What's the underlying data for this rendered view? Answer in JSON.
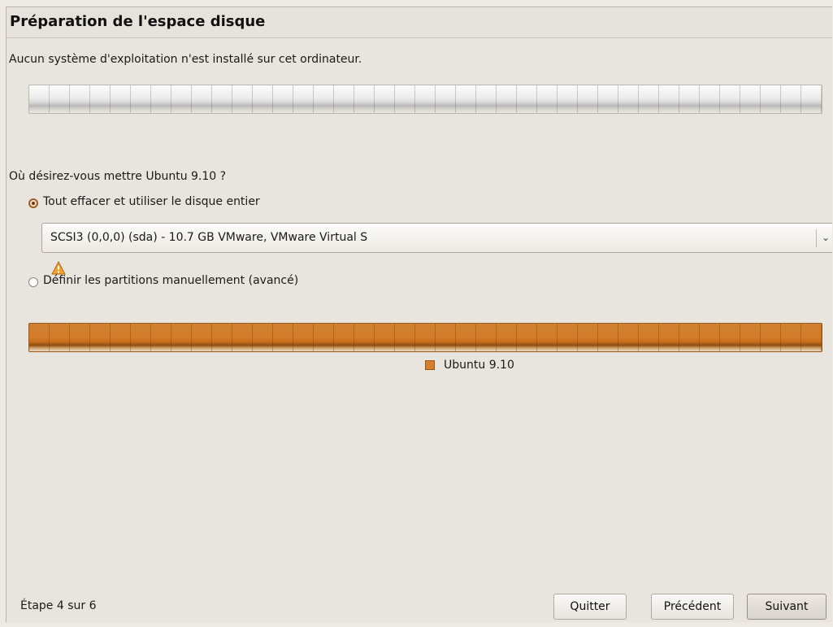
{
  "header": {
    "title": "Préparation de l'espace disque"
  },
  "disk_info": {
    "message": "Aucun système d'exploitation n'est installé sur cet ordinateur."
  },
  "installation": {
    "question": "Où désirez-vous mettre Ubuntu 9.10 ?",
    "option_erase": {
      "label": "Tout effacer et utiliser le disque entier",
      "selected": true
    },
    "disk_select": {
      "selected": "SCSI3 (0,0,0) (sda) - 10.7 GB VMware, VMware Virtual S"
    },
    "option_manual": {
      "label": "Définir les partitions manuellement (avancé)",
      "selected": false
    },
    "result_legend": {
      "label": "Ubuntu 9.10",
      "color": "#d6802c"
    }
  },
  "footer": {
    "step": "Étape 4 sur 6",
    "quit": "Quitter",
    "previous": "Précédent",
    "next": "Suivant"
  },
  "colors": {
    "accent": "#d6802c",
    "window_background": "#e8e4de"
  },
  "icons": {
    "warning": "warning-icon",
    "dropdown": "chevron-down-icon"
  }
}
